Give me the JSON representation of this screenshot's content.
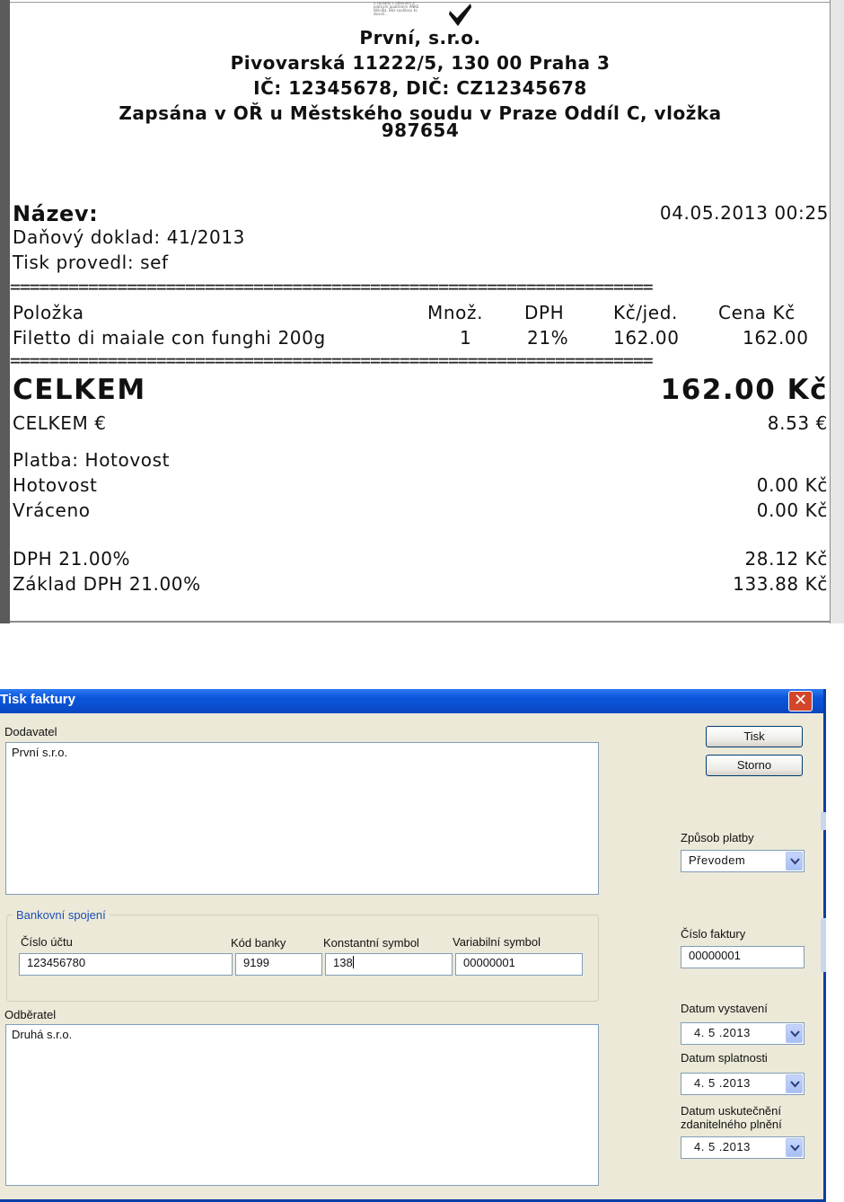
{
  "receipt": {
    "logo_small_text": "v souladu s zákonem a platným opatřením ANKE dělníka. Bez souhlasu to dovolí...",
    "company": "První, s.r.o.",
    "address": "Pivovarská  11222/5, 130 00 Praha 3",
    "ids": "IČ: 12345678, DIČ: CZ12345678",
    "register_line1": "Zapsána v OŘ u Městského soudu v Praze Oddíl C, vložka",
    "register_line2": "987654",
    "name_label": "Název:",
    "datetime": "04.05.2013 00:25",
    "tax_doc": "Daňový doklad: 41/2013",
    "printed_by": "Tisk provedl: sef",
    "separator": "==================================================================",
    "headers": {
      "item": "Položka",
      "qty": "Množ.",
      "vat": "DPH",
      "unit": "Kč/jed.",
      "price": "Cena Kč"
    },
    "row": {
      "item": "Filetto di maiale con funghi 200g",
      "qty": "1",
      "vat": "21%",
      "unit": "162.00",
      "price": "162.00"
    },
    "total_label": "CELKEM",
    "total_value": "162.00 Kč",
    "total_eur_label": "CELKEM €",
    "total_eur_value": "8.53 €",
    "payment": "Platba: Hotovost",
    "cash_label": "Hotovost",
    "cash_value": "0.00 Kč",
    "change_label": "Vráceno",
    "change_value": "0.00 Kč",
    "vat_label": "DPH 21.00%",
    "vat_value": "28.12 Kč",
    "base_label": "Základ DPH 21.00%",
    "base_value": "133.88 Kč"
  },
  "dialog": {
    "title": "Tisk faktury",
    "close_glyph": "✕",
    "supplier_label": "Dodavatel",
    "supplier_value": "První s.r.o.",
    "bank_group_label": "Bankovní spojení",
    "account_label": "Číslo účtu",
    "account_value": "123456780",
    "bank_code_label": "Kód banky",
    "bank_code_value": "9199",
    "const_symbol_label": "Konstantní symbol",
    "const_symbol_value": "138",
    "var_symbol_label": "Variabilní symbol",
    "var_symbol_value": "00000001",
    "customer_label": "Odběratel",
    "customer_value": "Druhá s.r.o.",
    "print_button": "Tisk",
    "cancel_button": "Storno",
    "payment_method_label": "Způsob platby",
    "payment_method_value": "Převodem",
    "invoice_number_label": "Číslo faktury",
    "invoice_number_value": "00000001",
    "issue_date_label": "Datum vystavení",
    "issue_date_value": "4. 5 .2013",
    "due_date_label": "Datum splatnosti",
    "due_date_value": "4. 5 .2013",
    "taxable_date_label_line1": "Datum uskutečnění",
    "taxable_date_label_line2": "zdanitelného plnění",
    "taxable_date_value": "4. 5 .2013"
  }
}
